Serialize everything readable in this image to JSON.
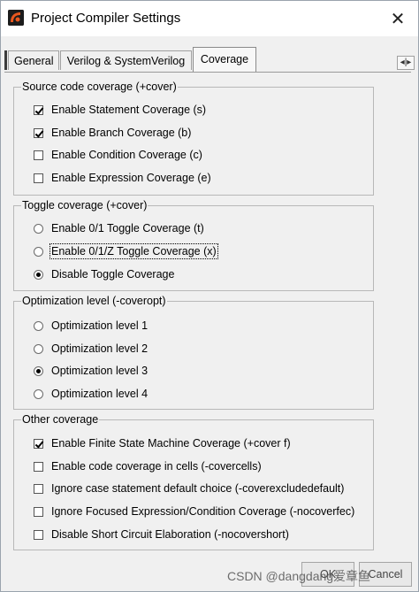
{
  "window": {
    "title": "Project Compiler Settings",
    "close_glyph": "✕"
  },
  "tabs": [
    {
      "label": "General",
      "active": false
    },
    {
      "label": "Verilog & SystemVerilog",
      "active": false
    },
    {
      "label": "Coverage",
      "active": true
    }
  ],
  "tab_scroll_glyph": "◂|▸",
  "groups": {
    "source": {
      "title": "Source code coverage (+cover)",
      "options": [
        {
          "label": "Enable Statement Coverage (s)",
          "checked": true
        },
        {
          "label": "Enable Branch Coverage (b)",
          "checked": true
        },
        {
          "label": "Enable Condition Coverage (c)",
          "checked": false
        },
        {
          "label": "Enable Expression Coverage (e)",
          "checked": false
        }
      ]
    },
    "toggle": {
      "title": "Toggle coverage (+cover)",
      "options": [
        {
          "label": "Enable 0/1 Toggle Coverage (t)",
          "selected": false
        },
        {
          "label": "Enable 0/1/Z Toggle Coverage (x)",
          "selected": false,
          "focused": true
        },
        {
          "label": "Disable Toggle Coverage",
          "selected": true
        }
      ]
    },
    "optimization": {
      "title": "Optimization level (-coveropt)",
      "options": [
        {
          "label": "Optimization level 1",
          "selected": false
        },
        {
          "label": "Optimization level 2",
          "selected": false
        },
        {
          "label": "Optimization level 3",
          "selected": true
        },
        {
          "label": "Optimization level 4",
          "selected": false
        }
      ]
    },
    "other": {
      "title": "Other coverage",
      "options": [
        {
          "label": "Enable Finite State Machine Coverage (+cover f)",
          "checked": true
        },
        {
          "label": "Enable code coverage in cells (-covercells)",
          "checked": false
        },
        {
          "label": "Ignore case statement default choice (-coverexcludedefault)",
          "checked": false
        },
        {
          "label": "Ignore Focused Expression/Condition Coverage (-nocoverfec)",
          "checked": false
        },
        {
          "label": "Disable Short Circuit Elaboration (-nocovershort)",
          "checked": false
        }
      ]
    }
  },
  "buttons": {
    "ok": "OK",
    "cancel": "Cancel"
  },
  "watermark": "CSDN @dangdang爱章鱼"
}
